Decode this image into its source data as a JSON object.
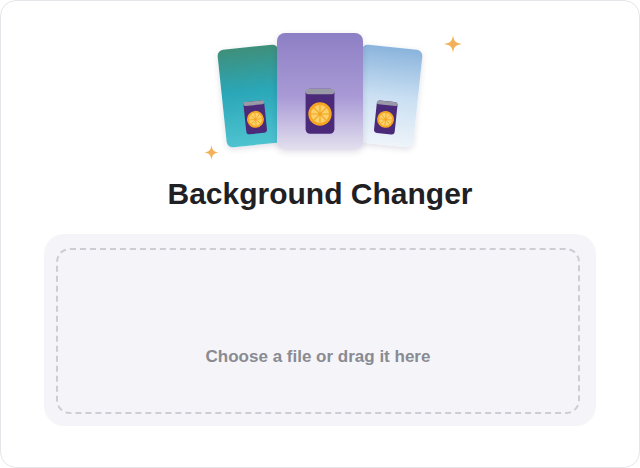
{
  "title": "Background Changer",
  "dropzone": {
    "prompt": "Choose a file or drag it here"
  }
}
